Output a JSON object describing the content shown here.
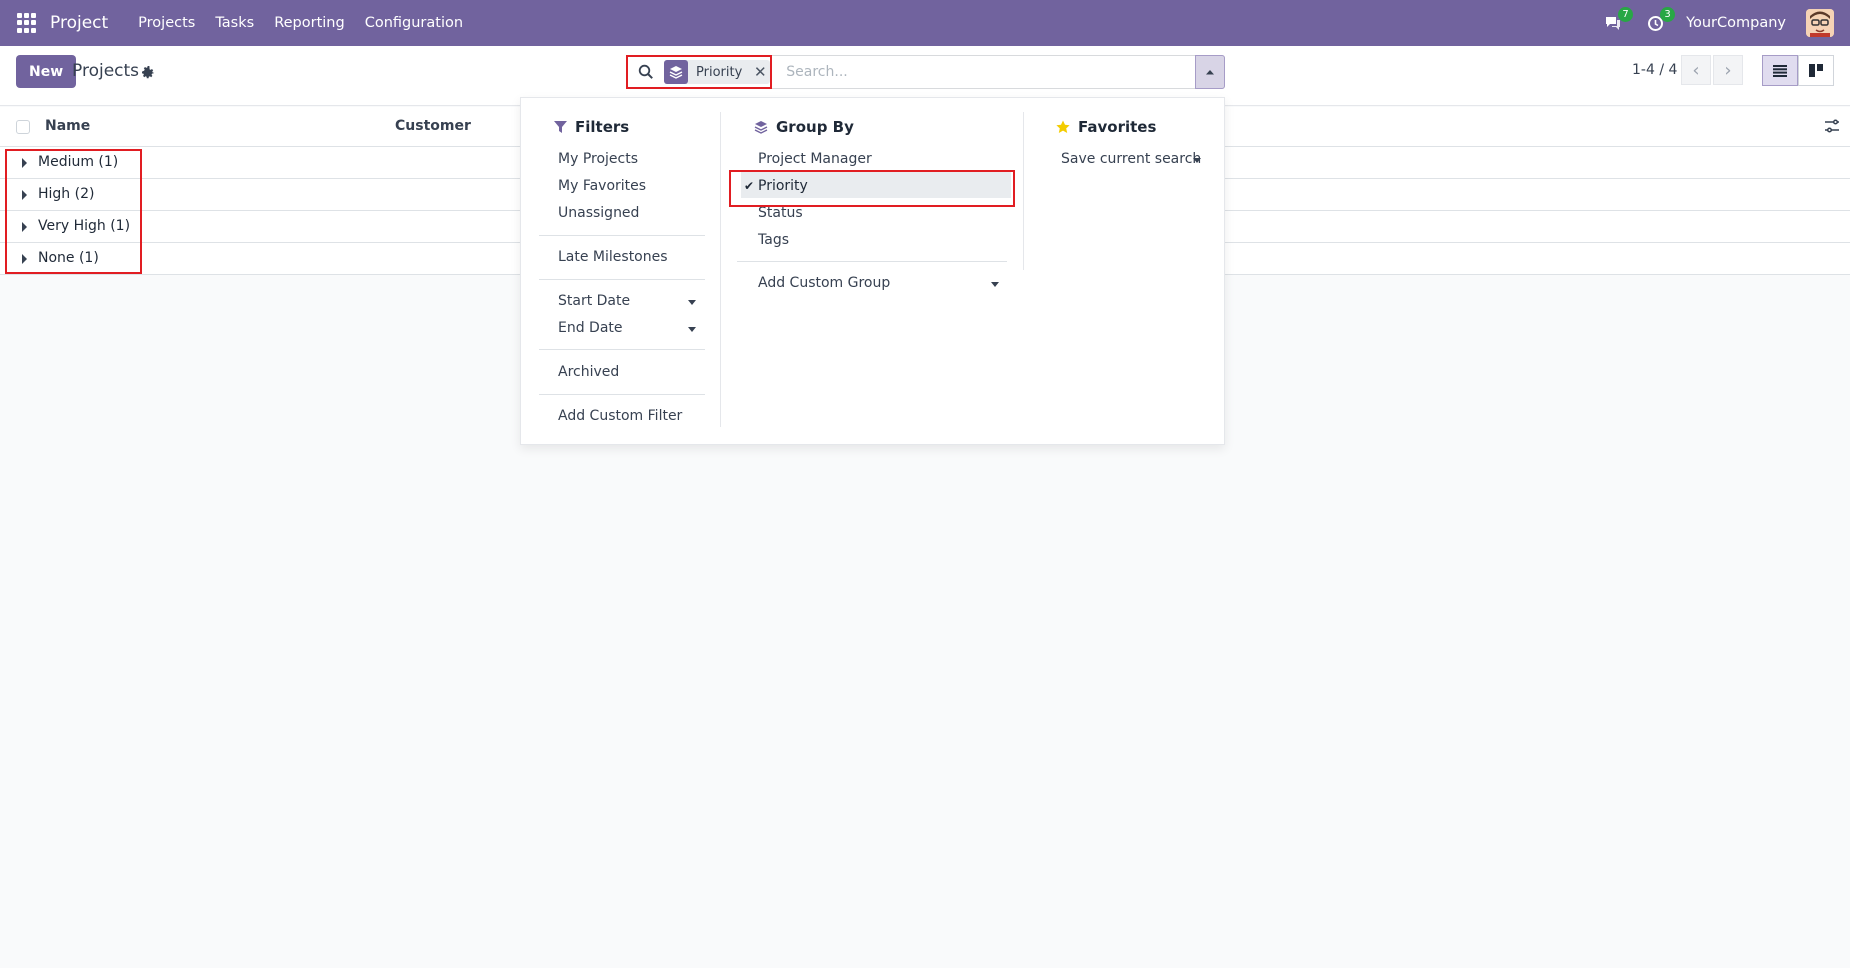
{
  "navbar": {
    "app_name": "Project",
    "menu": [
      "Projects",
      "Tasks",
      "Reporting",
      "Configuration"
    ],
    "messages_count": "7",
    "activities_count": "3",
    "company": "YourCompany",
    "bg_color": "#71639e"
  },
  "control_panel": {
    "new_label": "New",
    "title": "Projects",
    "search": {
      "facet_icon": "layers-icon",
      "facet_label": "Priority",
      "placeholder": "Search..."
    },
    "pager": "1-4 / 4"
  },
  "list": {
    "columns": [
      "Name",
      "Customer"
    ],
    "groups": [
      {
        "label": "Medium (1)"
      },
      {
        "label": "High (2)"
      },
      {
        "label": "Very High (1)"
      },
      {
        "label": "None (1)"
      }
    ]
  },
  "dropdown": {
    "filters": {
      "title": "Filters",
      "items": [
        "My Projects",
        "My Favorites",
        "Unassigned",
        "Late Milestones",
        "Start Date",
        "End Date",
        "Archived",
        "Add Custom Filter"
      ]
    },
    "group_by": {
      "title": "Group By",
      "items": [
        "Project Manager",
        "Priority",
        "Status",
        "Tags",
        "Add Custom Group"
      ],
      "selected": "Priority"
    },
    "favorites": {
      "title": "Favorites",
      "items": [
        "Save current search"
      ]
    }
  },
  "colors": {
    "accent": "#71639e",
    "highlight": "#e11d22",
    "badge": "#28a745"
  }
}
